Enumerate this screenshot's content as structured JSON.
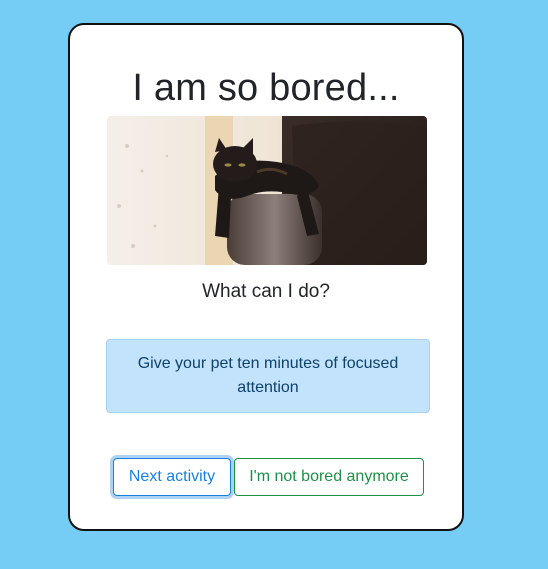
{
  "card": {
    "title": "I am so bored...",
    "image_alt": "cat-lying-on-couch-arm",
    "subtitle": "What can I do?",
    "activity_text": "Give your pet ten minutes of focused attention"
  },
  "buttons": {
    "next_label": "Next activity",
    "done_label": "I'm not bored anymore"
  },
  "colors": {
    "page_background": "#75cdf5",
    "alert_background": "#c3e2fb",
    "primary": "#1a7fde",
    "success": "#1f8f47"
  }
}
